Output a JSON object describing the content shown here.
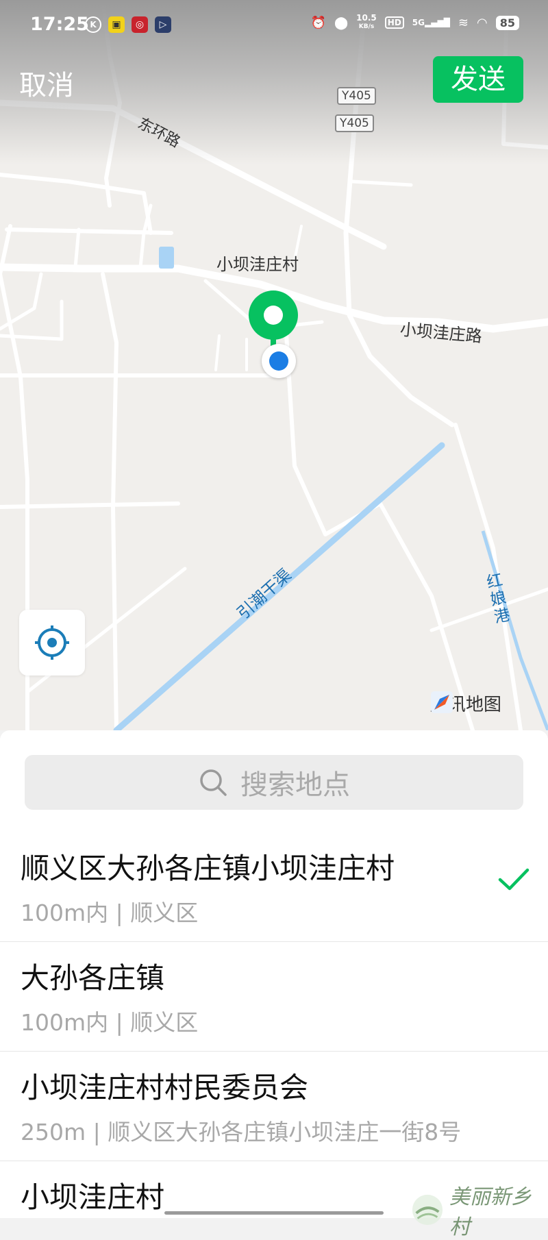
{
  "status_bar": {
    "time": "17:25",
    "net_speed_value": "10.5",
    "net_speed_unit": "KB/s",
    "hd": "HD",
    "signal": "5G",
    "battery": "85"
  },
  "header": {
    "cancel_label": "取消",
    "send_label": "发送"
  },
  "map": {
    "roads": {
      "dong_huan": "东环路",
      "y405_a": "Y405",
      "y405_b": "Y405",
      "village_road": "小坝洼庄路"
    },
    "village_label": "小坝洼庄村",
    "canal_label": "引潮干渠",
    "river_label": "红娘港",
    "provider": "腾讯地图",
    "colors": {
      "pin": "#07c160",
      "my_location": "#1b7de4",
      "water": "#a9d3f5"
    }
  },
  "search": {
    "placeholder": "搜索地点"
  },
  "places": [
    {
      "title": "顺义区大孙各庄镇小坝洼庄村",
      "subtitle": "100m内 | 顺义区",
      "selected": true
    },
    {
      "title": "大孙各庄镇",
      "subtitle": "100m内 | 顺义区",
      "selected": false
    },
    {
      "title": "小坝洼庄村村民委员会",
      "subtitle": "250m | 顺义区大孙各庄镇小坝洼庄一街8号",
      "selected": false
    },
    {
      "title": "小坝洼庄村",
      "subtitle": "",
      "selected": false
    }
  ],
  "watermark": "美丽新乡村"
}
